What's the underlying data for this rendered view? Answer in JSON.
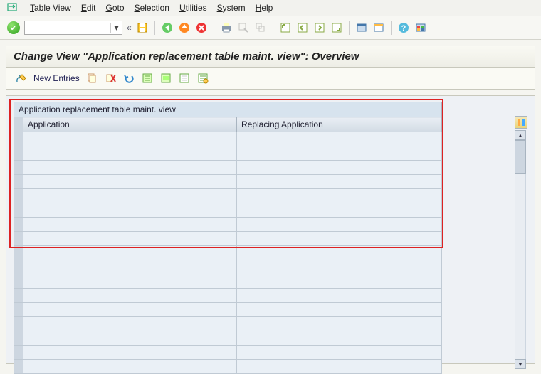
{
  "menu": {
    "items": [
      "Table View",
      "Edit",
      "Goto",
      "Selection",
      "Utilities",
      "System",
      "Help"
    ]
  },
  "systoolbar": {
    "cmd_value": "",
    "back_lbl": "«"
  },
  "title": "Change View \"Application replacement table maint. view\": Overview",
  "apptoolbar": {
    "new_entries": "New Entries"
  },
  "grid": {
    "caption": "Application replacement table maint. view",
    "col1": "Application",
    "col2": "Replacing Application",
    "rows": 17
  }
}
